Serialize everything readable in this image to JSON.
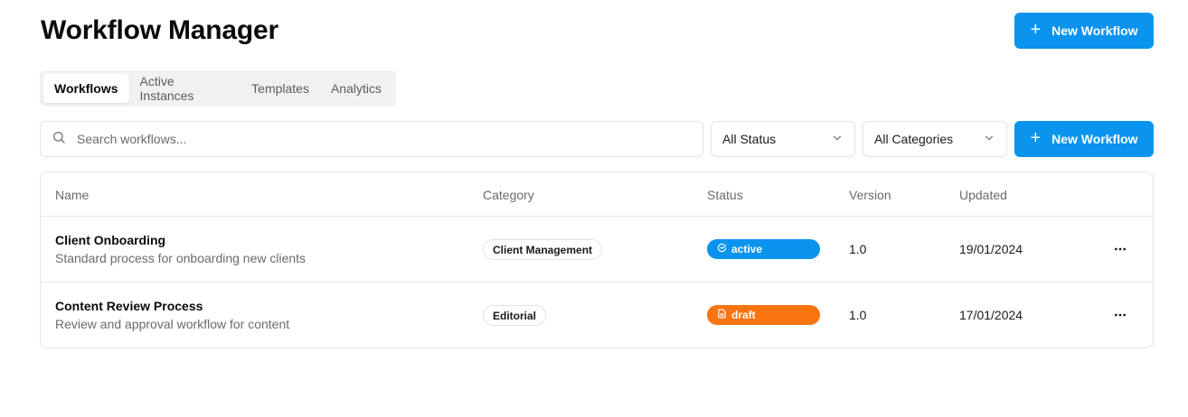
{
  "header": {
    "title": "Workflow Manager",
    "new_button": "New Workflow"
  },
  "tabs": [
    {
      "label": "Workflows",
      "active": true
    },
    {
      "label": "Active Instances",
      "active": false
    },
    {
      "label": "Templates",
      "active": false
    },
    {
      "label": "Analytics",
      "active": false
    }
  ],
  "filters": {
    "search_placeholder": "Search workflows...",
    "status_value": "All Status",
    "category_value": "All Categories",
    "new_button": "New Workflow"
  },
  "table": {
    "columns": [
      "Name",
      "Category",
      "Status",
      "Version",
      "Updated"
    ],
    "rows": [
      {
        "name": "Client Onboarding",
        "description": "Standard process for onboarding new clients",
        "category": "Client Management",
        "status": "active",
        "status_icon": "check-circle-icon",
        "status_color": "#0b94ee",
        "version": "1.0",
        "updated": "19/01/2024"
      },
      {
        "name": "Content Review Process",
        "description": "Review and approval workflow for content",
        "category": "Editorial",
        "status": "draft",
        "status_icon": "file-icon",
        "status_color": "#f9730e",
        "version": "1.0",
        "updated": "17/01/2024"
      }
    ]
  },
  "colors": {
    "primary": "#0b94ee",
    "draft": "#f9730e",
    "border": "#e2e3e6",
    "muted_text": "#6b6b70"
  }
}
